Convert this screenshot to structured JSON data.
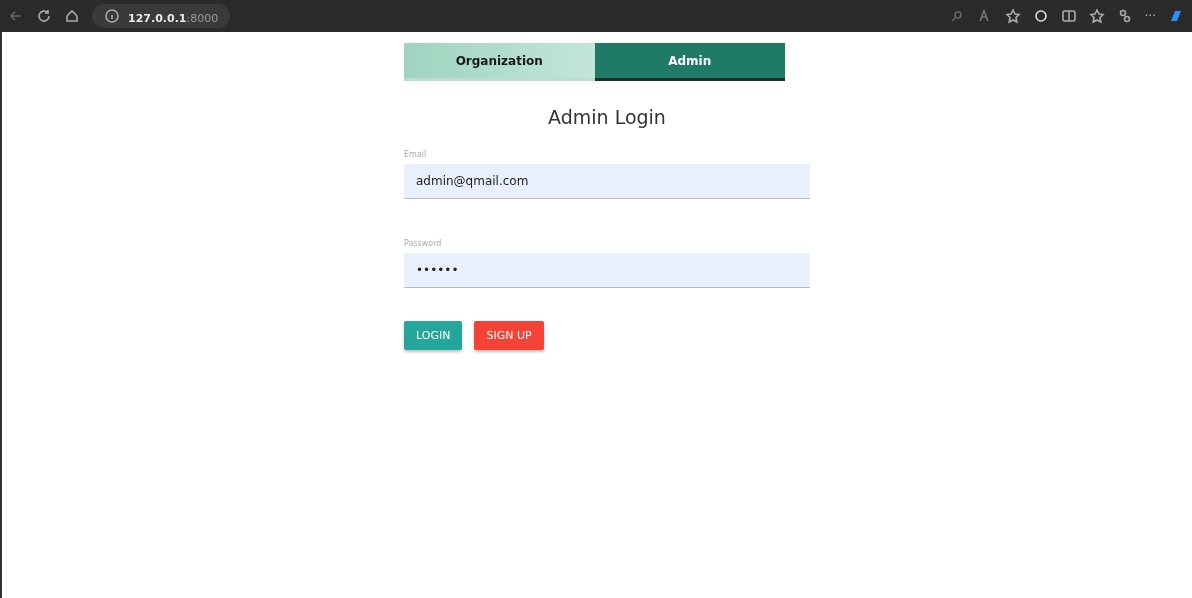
{
  "browser": {
    "address_host": "127.0.0.1",
    "address_port": ":8000",
    "more": "···"
  },
  "tabs": [
    {
      "label": "Organization",
      "selected": false
    },
    {
      "label": "Admin",
      "selected": true
    }
  ],
  "title": "Admin Login",
  "fields": [
    {
      "label": "Email",
      "value": "admin@qmail.com"
    },
    {
      "label": "Password",
      "value": "••••••"
    }
  ],
  "buttons": [
    {
      "label": "LOGIN",
      "kind": "primary"
    },
    {
      "label": "SIGN UP",
      "kind": "danger"
    }
  ]
}
